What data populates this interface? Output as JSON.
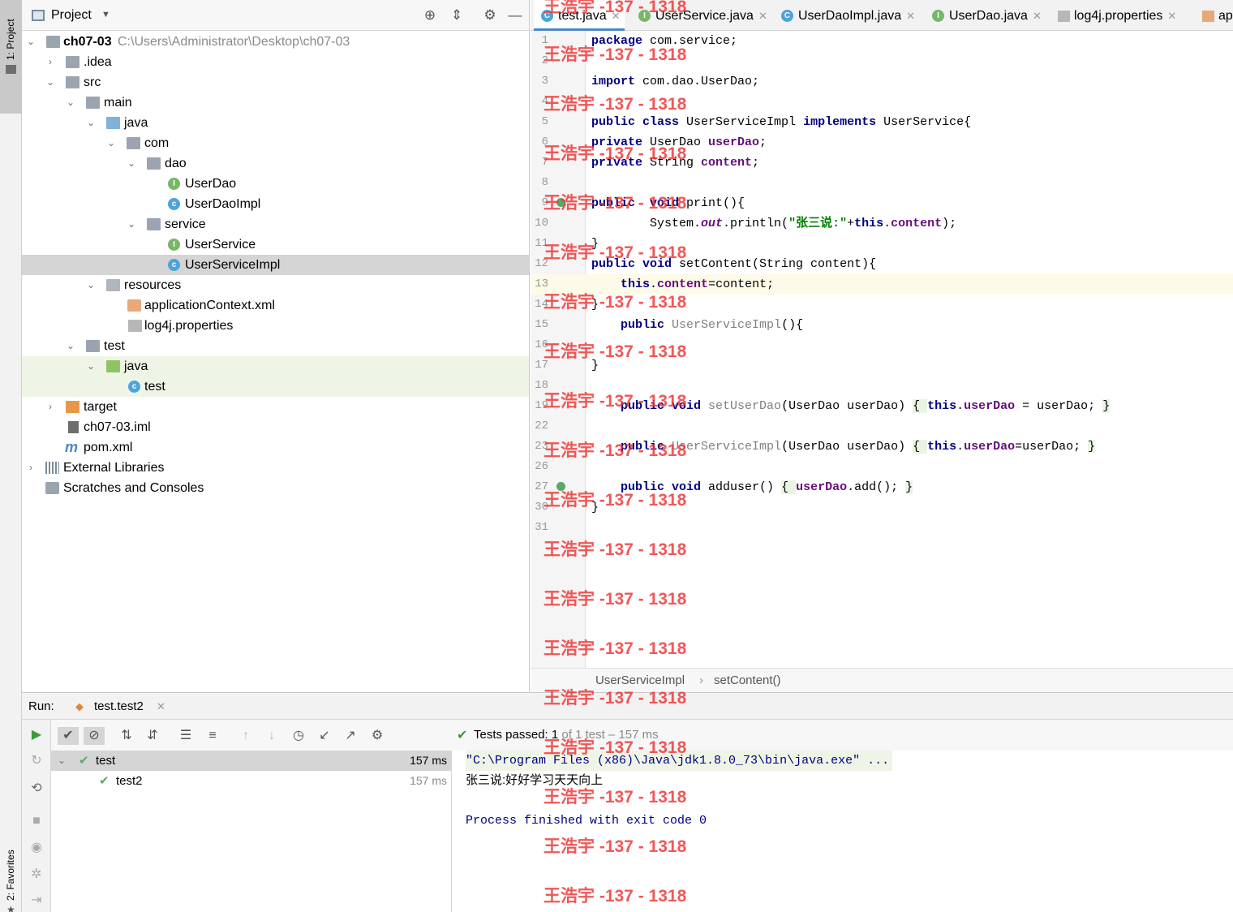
{
  "side_strip": {
    "top_label": "1: Project",
    "bottom_label": "2: Favorites"
  },
  "project": {
    "title": "Project",
    "tree": [
      {
        "label": "ch07-03",
        "path": "C:\\Users\\Administrator\\Desktop\\ch07-03"
      },
      {
        "label": ".idea"
      },
      {
        "label": "src"
      },
      {
        "label": "main"
      },
      {
        "label": "java"
      },
      {
        "label": "com"
      },
      {
        "label": "dao"
      },
      {
        "label": "UserDao"
      },
      {
        "label": "UserDaoImpl"
      },
      {
        "label": "service"
      },
      {
        "label": "UserService"
      },
      {
        "label": "UserServiceImpl"
      },
      {
        "label": "resources"
      },
      {
        "label": "applicationContext.xml"
      },
      {
        "label": "log4j.properties"
      },
      {
        "label": "test"
      },
      {
        "label": "java"
      },
      {
        "label": "test"
      },
      {
        "label": "target"
      },
      {
        "label": "ch07-03.iml"
      },
      {
        "label": "pom.xml"
      },
      {
        "label": "External Libraries"
      },
      {
        "label": "Scratches and Consoles"
      }
    ]
  },
  "editor": {
    "tabs": [
      {
        "label": "test.java",
        "icon": "C"
      },
      {
        "label": "UserService.java",
        "icon": "I"
      },
      {
        "label": "UserDaoImpl.java",
        "icon": "C"
      },
      {
        "label": "UserDao.java",
        "icon": "I"
      },
      {
        "label": "log4j.properties",
        "icon": "properties-icon"
      },
      {
        "label": "ap",
        "icon": "xml-icon"
      }
    ],
    "line_numbers": [
      "1",
      "2",
      "3",
      "4",
      "5",
      "6",
      "7",
      "8",
      "9",
      "10",
      "11",
      "12",
      "13",
      "14",
      "15",
      "16",
      "17",
      "18",
      "19",
      "22",
      "23",
      "26",
      "27",
      "30",
      "31"
    ],
    "lines": {
      "l1a": "package",
      "l1b": " com.service;",
      "l3a": "import",
      "l3b": " com.dao.UserDao;",
      "l5a": "public class",
      "l5b": " UserServiceImpl ",
      "l5c": "implements",
      "l5d": " UserService{",
      "l6a": "private",
      "l6b": " UserDao ",
      "l6c": "userDao",
      "l6d": ";",
      "l7a": "private",
      "l7b": " String ",
      "l7c": "content",
      "l7d": ";",
      "l9a": "public",
      "l9b": "  ",
      "l9c": "void",
      "l9d": " print(){",
      "l10a": "        System.",
      "l10b": "out",
      "l10c": ".println(",
      "l10d": "\"张三说:\"",
      "l10e": "+",
      "l10f": "this",
      "l10g": ".",
      "l10h": "content",
      "l10i": ");",
      "l11": "}",
      "l12a": "public void",
      "l12b": " setContent(String content){",
      "l13a": "    ",
      "l13b": "this",
      "l13c": ".",
      "l13d": "content",
      "l13e": "=content;",
      "l14": "}",
      "l15a": "    ",
      "l15b": "public",
      "l15c": " UserServiceImpl",
      "l15d": "(){",
      "l17": "}",
      "l19a": "    ",
      "l19b": "public void",
      "l19c": " setUserDao",
      "l19d": "(UserDao userDao) ",
      "l19e": "{ ",
      "l19f": "this",
      "l19g": ".",
      "l19h": "userDao",
      "l19i": " = userDao; ",
      "l19j": "}",
      "l23a": "    ",
      "l23b": "public",
      "l23c": " UserServiceImpl",
      "l23d": "(UserDao userDao) ",
      "l23e": "{ ",
      "l23f": "this",
      "l23g": ".",
      "l23h": "userDao",
      "l23i": "=userDao; ",
      "l23j": "}",
      "l27a": "    ",
      "l27b": "public void",
      "l27c": " adduser() ",
      "l27d": "{ ",
      "l27e": "userDao",
      "l27f": ".add(); ",
      "l27g": "}",
      "l30": "}"
    },
    "breadcrumb": [
      "UserServiceImpl",
      "setContent()"
    ]
  },
  "run": {
    "label": "Run:",
    "tab": "test.test2",
    "status_prefix": "Tests passed: ",
    "status_count": "1",
    "status_rest": " of 1 test – 157 ms",
    "tree": [
      {
        "label": "test",
        "time": "157 ms"
      },
      {
        "label": "test2",
        "time": "157 ms"
      }
    ],
    "console": [
      "\"C:\\Program Files (x86)\\Java\\jdk1.8.0_73\\bin\\java.exe\" ...",
      "张三说:好好学习天天向上",
      "",
      "Process finished with exit code 0"
    ]
  },
  "watermark": "王浩宇 -137 - 1318",
  "colors": {
    "accent": "#4a88c7",
    "keyword": "#000080",
    "field": "#660e7a",
    "string": "#008000",
    "pass": "#59a869",
    "watermark": "#ee3333"
  }
}
